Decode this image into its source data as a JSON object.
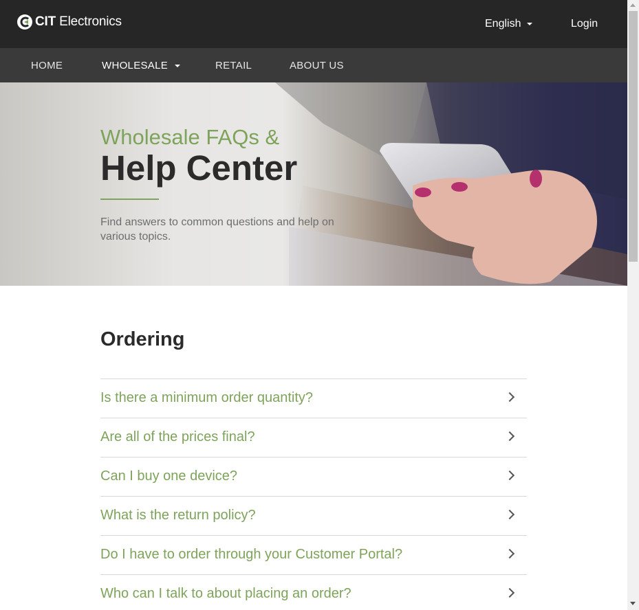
{
  "header": {
    "logo_text_bold": "CIT",
    "logo_text": " Electronics",
    "language": "English",
    "login": "Login"
  },
  "nav": {
    "items": [
      {
        "label": "HOME"
      },
      {
        "label": "WHOLESALE"
      },
      {
        "label": "RETAIL"
      },
      {
        "label": "ABOUT US"
      }
    ]
  },
  "hero": {
    "subtitle": "Wholesale FAQs &",
    "title": "Help Center",
    "description": "Find answers to common questions and help on various topics."
  },
  "section": {
    "title": "Ordering",
    "faqs": [
      {
        "question": "Is there a minimum order quantity?"
      },
      {
        "question": "Are all of the prices final?"
      },
      {
        "question": "Can I buy one device?"
      },
      {
        "question": "What is the return policy?"
      },
      {
        "question": "Do I have to order through your Customer Portal?"
      },
      {
        "question": "Who can I talk to about placing an order?"
      }
    ]
  },
  "colors": {
    "accent": "#7ea35b",
    "topbar": "#262626",
    "navbar": "#3a3a3a",
    "heading": "#2b2b2b"
  },
  "icons": {
    "logo": "cit-logo-icon",
    "language_caret": "chevron-down-icon",
    "faq_chevron": "chevron-right-icon"
  }
}
